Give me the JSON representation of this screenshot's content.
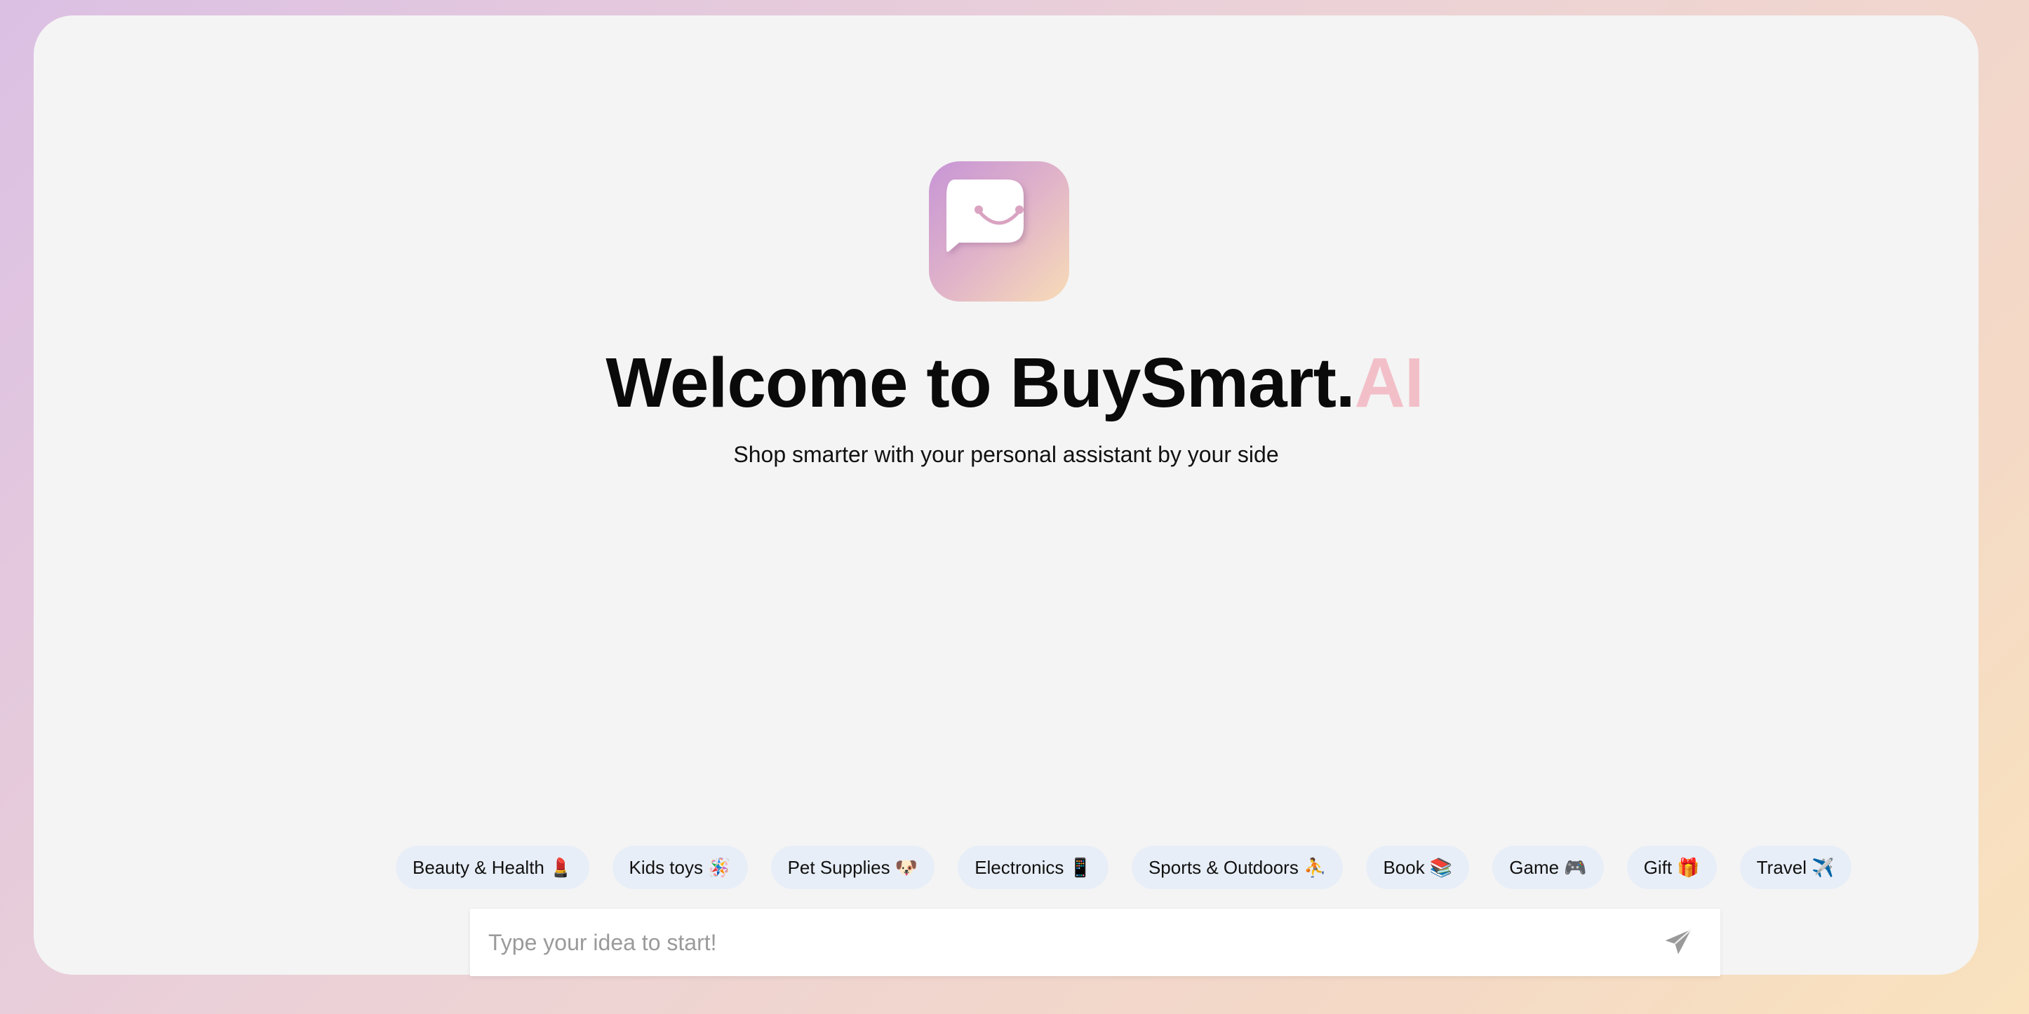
{
  "app": {
    "title_main": "Welcome to BuySmart.",
    "title_accent": "AI",
    "subtitle": "Shop smarter with your personal assistant by your side",
    "logo_icon": "shopping-bag-chat-icon"
  },
  "categories": [
    {
      "label": "Beauty & Health 💄"
    },
    {
      "label": "Kids toys 🪅"
    },
    {
      "label": "Pet Supplies 🐶"
    },
    {
      "label": "Electronics 📱"
    },
    {
      "label": "Sports & Outdoors ⛹️"
    },
    {
      "label": "Book 📚"
    },
    {
      "label": "Game 🎮"
    },
    {
      "label": "Gift 🎁"
    },
    {
      "label": "Travel ✈️"
    }
  ],
  "input": {
    "value": "",
    "placeholder": "Type your idea to start!",
    "send_icon": "send-icon"
  },
  "colors": {
    "accent": "#f2bfc8",
    "chip_bg": "#e8eef7",
    "card_bg": "#f4f4f4"
  }
}
